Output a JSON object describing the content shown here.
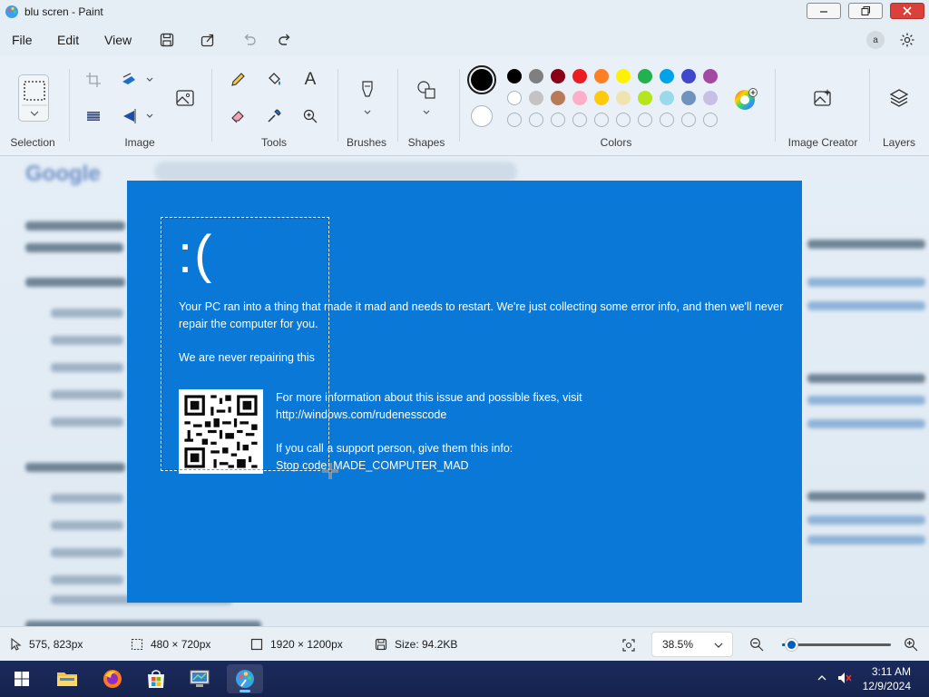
{
  "window": {
    "title": "blu scren - Paint",
    "controls": {
      "minimize": "minimize",
      "maximize": "maximize",
      "close": "close"
    }
  },
  "menu": {
    "items": [
      "File",
      "Edit",
      "View"
    ],
    "account_initial": "a"
  },
  "ribbon": {
    "groups": {
      "selection": "Selection",
      "image": "Image",
      "tools": "Tools",
      "brushes": "Brushes",
      "shapes": "Shapes",
      "colors": "Colors",
      "image_creator": "Image Creator",
      "layers": "Layers"
    },
    "text_tool_glyph": "A",
    "primary_color": "#000000",
    "secondary_color": "#ffffff",
    "palette_row1": [
      "#000000",
      "#7f7f7f",
      "#880015",
      "#ed1c24",
      "#ff7f27",
      "#fff200",
      "#22b14c",
      "#00a2e8",
      "#3f48cc",
      "#a349a4"
    ],
    "palette_row2": [
      "#ffffff",
      "#c3c3c3",
      "#b97a57",
      "#ffaec9",
      "#ffc90e",
      "#efe4b0",
      "#b5e61d",
      "#99d9ea",
      "#7092be",
      "#c8bfe7"
    ],
    "palette_row3_count": 10
  },
  "canvas": {
    "background": "#0a78d7",
    "face": ":(",
    "message": "Your PC ran into a thing that made it mad and needs to restart. We're just collecting some error info, and then we'll never repair the computer for you.",
    "progress": "We are never repairing this",
    "info_line1": "For more information about this issue and possible fixes, visit",
    "info_url": "http://windows.com/rudenesscode",
    "support_line": "If you call a support person, give them this info:",
    "stop_code": "Stop code: MADE_COMPUTER_MAD"
  },
  "background_page": {
    "logo": "Google"
  },
  "status": {
    "cursor_pos": "575, 823px",
    "selection_size": "480 × 720px",
    "canvas_size": "1920 × 1200px",
    "file_size": "Size: 94.2KB",
    "zoom": "38.5%",
    "zoom_fraction": 0.08
  },
  "taskbar": {
    "apps": [
      "start",
      "file-explorer",
      "firefox",
      "microsoft-store",
      "system-app",
      "paint"
    ],
    "time": "3:11 AM",
    "date": "12/9/2024"
  }
}
